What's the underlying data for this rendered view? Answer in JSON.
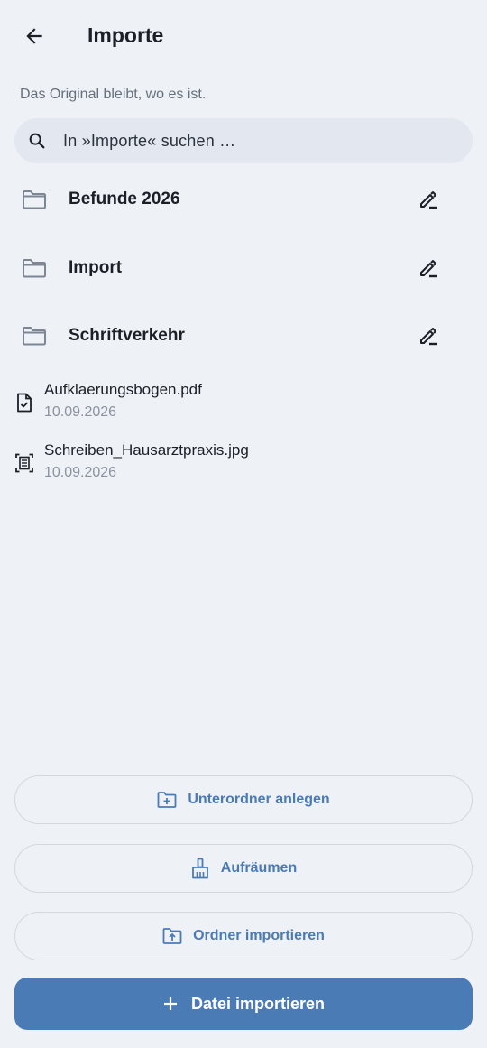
{
  "header": {
    "title": "Importe",
    "back_icon": "arrow-left-icon"
  },
  "subtitle": "Das Original bleibt, wo es ist.",
  "search": {
    "placeholder": "In »Importe« suchen …",
    "icon": "search-icon"
  },
  "folders": [
    {
      "name": "Befunde 2026",
      "icon": "folder-icon",
      "action_icon": "edit-icon"
    },
    {
      "name": "Import",
      "icon": "folder-icon",
      "action_icon": "edit-icon"
    },
    {
      "name": "Schriftverkehr",
      "icon": "folder-icon",
      "action_icon": "edit-icon"
    }
  ],
  "files": [
    {
      "name": "Aufklaerungsbogen.pdf",
      "date": "10.09.2026",
      "icon": "pdf-document-icon"
    },
    {
      "name": "Schreiben_Hausarztpraxis.jpg",
      "date": "10.09.2026",
      "icon": "scanned-document-icon"
    }
  ],
  "actions": {
    "new_subfolder": {
      "label": "Unterordner anlegen",
      "icon": "folder-add-icon"
    },
    "cleanup": {
      "label": "Aufräumen",
      "icon": "broom-icon"
    },
    "import_folder": {
      "label": "Ordner importieren",
      "icon": "folder-upload-icon"
    },
    "import_file": {
      "label": "Datei importieren",
      "icon": "plus-icon"
    }
  },
  "colors": {
    "background": "#eef1f6",
    "accent": "#4a7bb5",
    "search_bg": "#e3e8f0",
    "muted_text": "#66707d",
    "date_text": "#8a93a0"
  }
}
